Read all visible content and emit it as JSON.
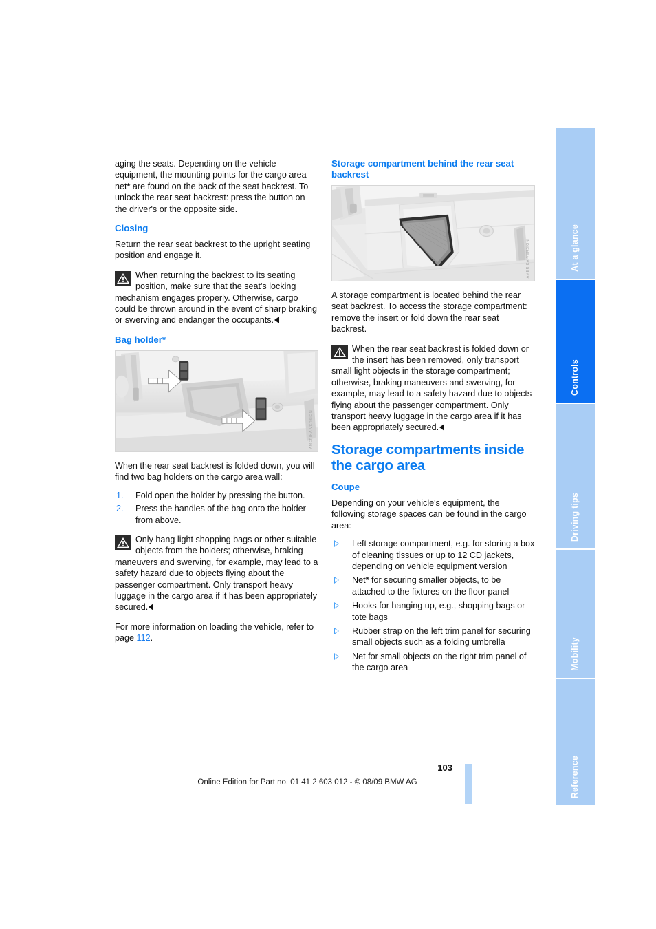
{
  "document": {
    "page_number": "103",
    "footer": "Online Edition for Part no. 01 41 2 603 012 - © 08/09 BMW AG"
  },
  "sidebar": {
    "tabs": [
      {
        "label": "At a glance",
        "active": false
      },
      {
        "label": "Controls",
        "active": true
      },
      {
        "label": "Driving tips",
        "active": false
      },
      {
        "label": "Mobility",
        "active": false
      },
      {
        "label": "Reference",
        "active": false
      }
    ]
  },
  "left_column": {
    "continued_paragraph": "aging the seats. Depending on the vehicle equipment, the mounting points for the cargo area net",
    "continued_paragraph_2": " are found on the back of the seat backrest. To unlock the rear seat backrest: press the button on the driver's or the opposite side.",
    "closing_heading": "Closing",
    "closing_text": "Return the rear seat backrest to the upright seating position and engage it.",
    "warning_1": "When returning the backrest to its seating position, make sure that the seat's locking mechanism engages properly. Otherwise, cargo could be thrown around in the event of sharp braking or swerving and endanger the occupants.",
    "bag_holder_heading": "Bag holder*",
    "figure_bag_holder": {
      "caption_code": "AMERIKA-VERSION",
      "alt": "Cargo area wall with two bag holders indicated by white arrows"
    },
    "bag_holder_intro": "When the rear seat backrest is folded down, you will find two bag holders on the cargo area wall:",
    "steps": [
      {
        "num": "1.",
        "text": "Fold open the holder by pressing the button."
      },
      {
        "num": "2.",
        "text": "Press the handles of the bag onto the holder from above."
      }
    ],
    "warning_2": "Only hang light shopping bags or other suitable objects from the holders; otherwise, braking maneuvers and swerving, for example, may lead to a safety hazard due to objects flying about the passenger compartment. Only transport heavy luggage in the cargo area if it has been appropriately secured.",
    "more_info_prefix": "For more information on loading the vehicle, refer to page ",
    "more_info_page": "112",
    "more_info_suffix": "."
  },
  "right_column": {
    "storage_heading": "Storage compartment behind the rear seat backrest",
    "figure_storage": {
      "caption_code": "AMERIKA-VERSION",
      "alt": "Storage compartment behind the rear seat backrest with mesh insert"
    },
    "storage_text": "A storage compartment is located behind the rear seat backrest. To access the storage compartment: remove the insert or fold down the rear seat backrest.",
    "warning_3": "When the rear seat backrest is folded down or the insert has been removed, only transport small light objects in the storage compartment; otherwise, braking maneuvers and swerving, for example, may lead to a safety hazard due to objects flying about the passenger compartment. Only transport heavy luggage in the cargo area if it has been appropriately secured.",
    "main_heading": "Storage compartments inside the cargo area",
    "coupe_heading": "Coupe",
    "coupe_intro": "Depending on your vehicle's equipment, the following storage spaces can be found in the cargo area:",
    "bullets": [
      {
        "text": "Left storage compartment, e.g. for storing a box of cleaning tissues or up to 12 CD jackets, depending on vehicle equipment version"
      },
      {
        "text_pre": "Net",
        "star": "*",
        "text_post": " for securing smaller objects, to be attached to the fixtures on the floor panel"
      },
      {
        "text": "Hooks for hanging up, e.g., shopping bags or tote bags"
      },
      {
        "text": "Rubber strap on the left trim panel for securing small objects such as a folding umbrella"
      },
      {
        "text": "Net for small objects on the right trim panel of the cargo area"
      }
    ]
  },
  "colors": {
    "accent_blue": "#0b7cf0",
    "tab_inactive": "#a9cdf5",
    "tab_active": "#0b6ff2",
    "page_bar": "#b3d4f7"
  }
}
